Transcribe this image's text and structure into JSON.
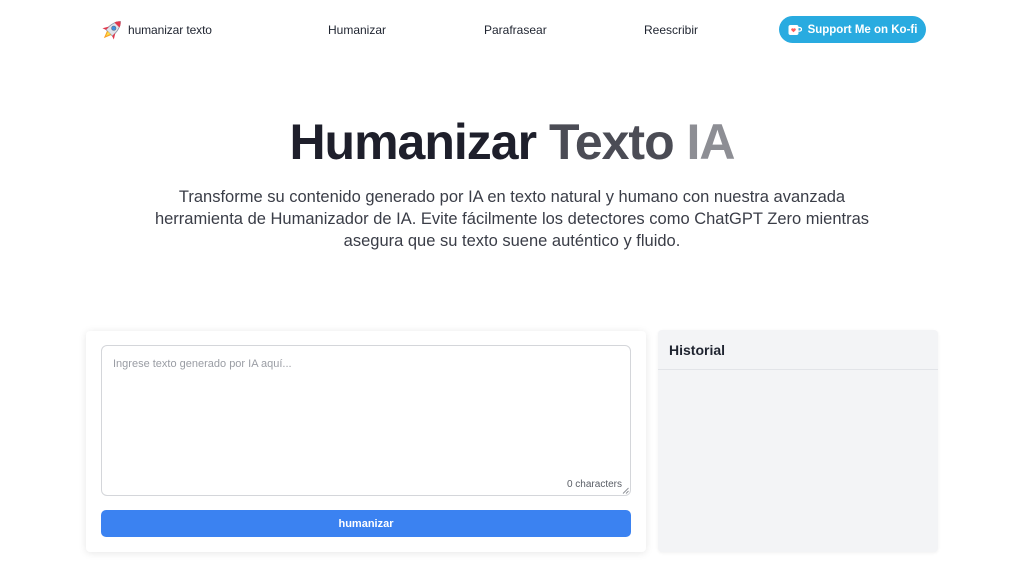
{
  "nav": {
    "brand": "humanizar texto",
    "links": [
      "Humanizar",
      "Parafrasear",
      "Reescribir"
    ],
    "support_label": "Support Me on Ko-fi",
    "support_color": "#29abe0"
  },
  "hero": {
    "title_part1": "Humanizar",
    "title_part2": "Texto",
    "title_part3": "IA",
    "subtitle": "Transforme su contenido generado por IA en texto natural y humano con nuestra avanzada herramienta de Humanizador de IA. Evite fácilmente los detectores como ChatGPT Zero mientras asegura que su texto suene auténtico y fluido."
  },
  "editor": {
    "placeholder": "Ingrese texto generado por IA aquí...",
    "value": "",
    "char_count": "0 characters",
    "button_label": "humanizar",
    "button_color": "#3b82f1"
  },
  "history": {
    "title": "Historial"
  },
  "icons": {
    "brand": "rocket-icon",
    "support": "kofi-cup-icon"
  }
}
